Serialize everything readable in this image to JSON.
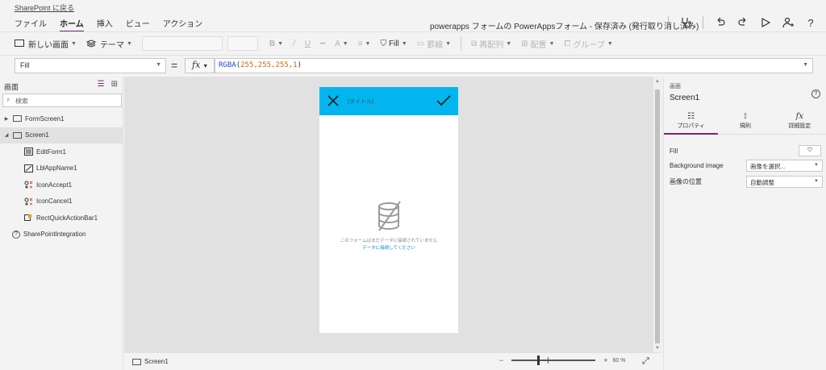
{
  "topbar": {
    "back_link": "SharePoint に戻る",
    "menu": [
      "ファイル",
      "ホーム",
      "挿入",
      "ビュー",
      "アクション"
    ],
    "active_menu": "ホーム",
    "doc_title": "powerapps フォームの PowerAppsフォーム - 保存済み (発行取り消し済み)"
  },
  "ribbon": {
    "new_screen": "新しい画面",
    "theme": "テーマ",
    "fill": "Fill",
    "border": "罫線",
    "reorder": "再配列",
    "align": "配置",
    "group": "グループ"
  },
  "formula": {
    "property": "Fill",
    "equals": "=",
    "fx": "fx",
    "fn": "RGBA",
    "args": "255,255,255,1"
  },
  "left": {
    "title": "画面",
    "search_placeholder": "検索",
    "items": [
      {
        "label": "FormScreen1"
      },
      {
        "label": "Screen1"
      },
      {
        "label": "EditForm1"
      },
      {
        "label": "LblAppName1"
      },
      {
        "label": "IconAccept1"
      },
      {
        "label": "IconCancel1"
      },
      {
        "label": "RectQuickActionBar1"
      },
      {
        "label": "SharePointIntegration"
      }
    ]
  },
  "device": {
    "title": "[タイトル]",
    "empty_msg": "このフォームはまだデータに接続されていません",
    "empty_link": "データに接続してください"
  },
  "status": {
    "screen": "Screen1",
    "zoom_minus": "−",
    "zoom_plus": "+",
    "zoom_value": "60",
    "zoom_unit": "%"
  },
  "right": {
    "head": "画面",
    "name": "Screen1",
    "tabs": [
      "プロパティ",
      "規則",
      "詳細設定"
    ],
    "fill_label": "Fill",
    "bg_image_label": "Background image",
    "bg_image_value": "画像を選択...",
    "image_pos_label": "画像の位置",
    "image_pos_value": "自動調整"
  },
  "colors": {
    "accent": "#742774",
    "header_blue": "#03b5ef",
    "link_blue": "#0f86d0"
  }
}
